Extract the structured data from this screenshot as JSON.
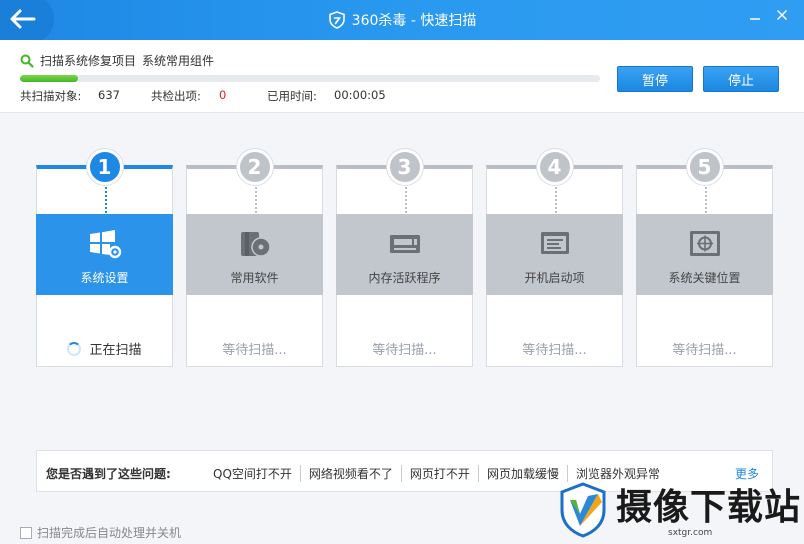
{
  "window": {
    "title": "360杀毒 - 快速扫描"
  },
  "status": {
    "scan_item": "扫描系统修复项目",
    "scan_sub": "系统常用组件",
    "progress": 0.1,
    "scanned_label": "共扫描对象:",
    "scanned_value": "637",
    "found_label": "共检出项:",
    "found_value": "0",
    "time_label": "已用时间:",
    "time_value": "00:00:05",
    "pause_label": "暂停",
    "stop_label": "停止"
  },
  "steps": [
    {
      "number": "1",
      "label": "系统设置",
      "state": "正在扫描",
      "icon": "windows-gear-icon"
    },
    {
      "number": "2",
      "label": "常用软件",
      "state": "等待扫描...",
      "icon": "software-disc-icon"
    },
    {
      "number": "3",
      "label": "内存活跃程序",
      "state": "等待扫描...",
      "icon": "memory-chip-icon"
    },
    {
      "number": "4",
      "label": "开机启动项",
      "state": "等待扫描...",
      "icon": "startup-screen-icon"
    },
    {
      "number": "5",
      "label": "系统关键位置",
      "state": "等待扫描...",
      "icon": "target-location-icon"
    }
  ],
  "problems": {
    "question": "您是否遇到了这些问题:",
    "links": [
      "QQ空间打不开",
      "网络视频看不了",
      "网页打不开",
      "网页加载缓慢",
      "浏览器外观异常"
    ],
    "more": "更多"
  },
  "footer": {
    "auto_shutdown": "扫描完成后自动处理并关机"
  },
  "watermark": {
    "text": "摄像下载站",
    "url": "sxtgr.com"
  },
  "colors": {
    "accent": "#1e88e5",
    "progress": "#45b724",
    "found": "#e02020",
    "inactive": "#c2c6cd"
  }
}
